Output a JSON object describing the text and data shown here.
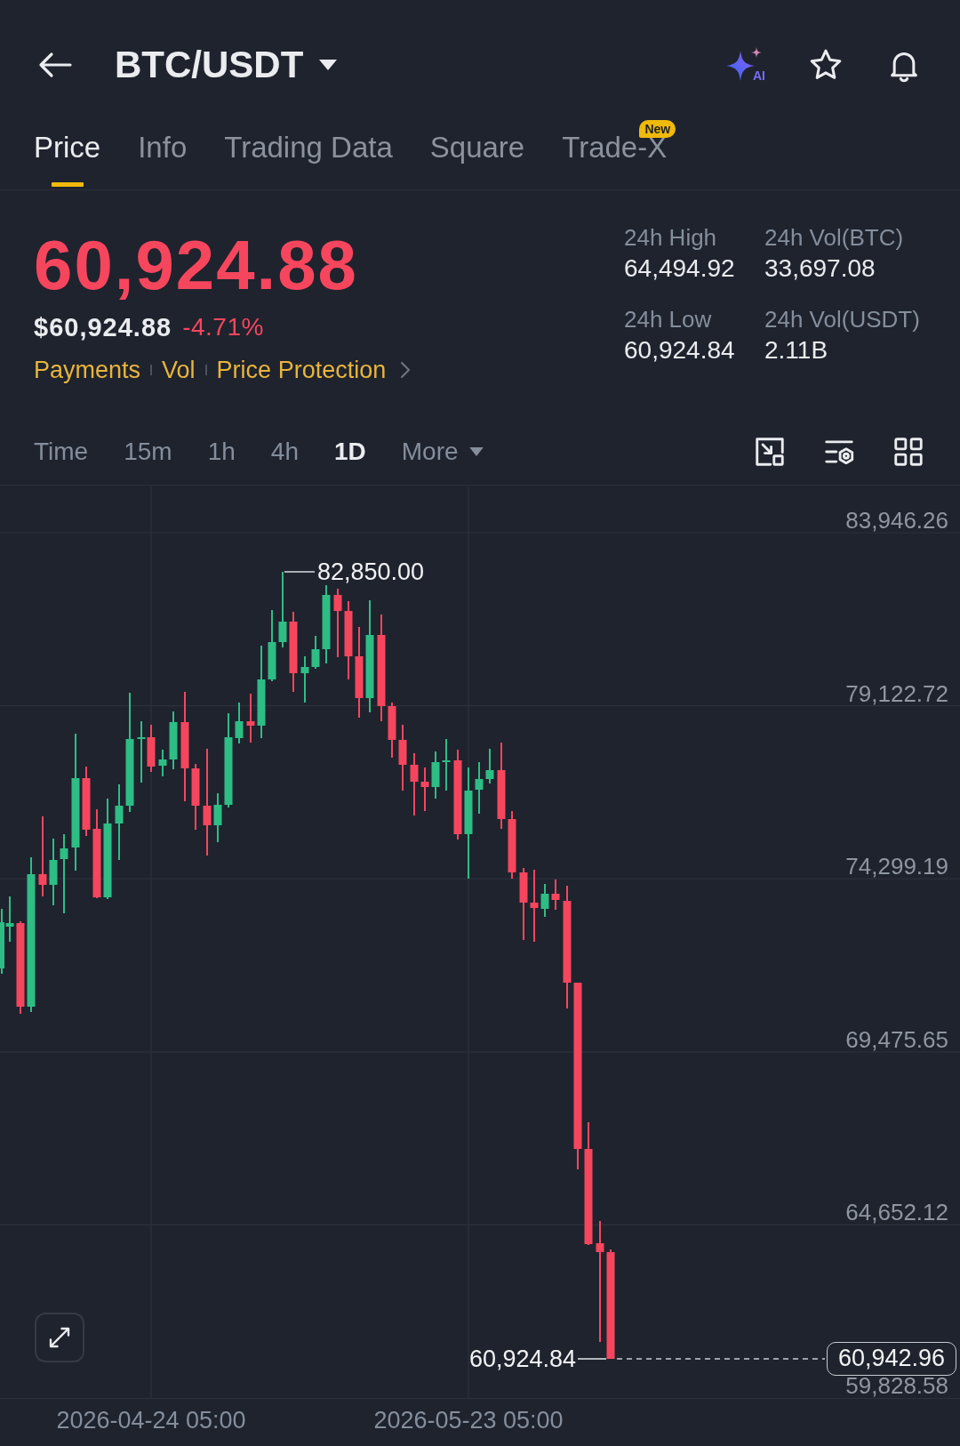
{
  "header": {
    "title": "BTC/USDT",
    "ai_label": "AI"
  },
  "tabs": [
    {
      "label": "Price",
      "selected": true
    },
    {
      "label": "Info",
      "selected": false
    },
    {
      "label": "Trading Data",
      "selected": false
    },
    {
      "label": "Square",
      "selected": false
    },
    {
      "label": "Trade-X",
      "selected": false,
      "badge": "New"
    }
  ],
  "ticker": {
    "last_price": "60,924.88",
    "falling": true,
    "usd_price": "$60,924.88",
    "change": "-4.71%",
    "links": [
      "Payments",
      "Vol",
      "Price Protection"
    ]
  },
  "stats": [
    {
      "label": "24h High",
      "value": "64,494.92"
    },
    {
      "label": "24h Vol(BTC)",
      "value": "33,697.08"
    },
    {
      "label": "24h Low",
      "value": "60,924.84"
    },
    {
      "label": "24h Vol(USDT)",
      "value": "2.11B"
    }
  ],
  "intervals": [
    {
      "label": "Time",
      "kind": "option",
      "selected": false
    },
    {
      "label": "15m",
      "kind": "option",
      "selected": false
    },
    {
      "label": "1h",
      "kind": "option",
      "selected": false
    },
    {
      "label": "4h",
      "kind": "option",
      "selected": false
    },
    {
      "label": "1D",
      "kind": "option",
      "selected": true
    },
    {
      "label": "More",
      "kind": "menu",
      "selected": false
    }
  ],
  "chart": {
    "price_axis": [
      "83,946.26",
      "79,122.72",
      "74,299.19",
      "69,475.65",
      "64,652.12",
      "59,828.58"
    ],
    "high_marker": "82,850.00",
    "low_marker": "60,924.84",
    "last_price_tag": "60,942.96",
    "time_axis": [
      "2026-04-24 05:00",
      "2026-05-23 05:00"
    ]
  }
}
